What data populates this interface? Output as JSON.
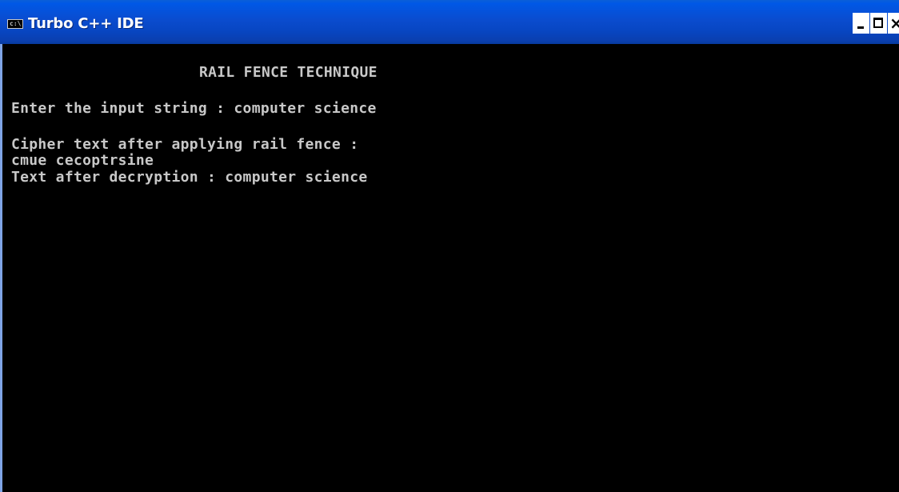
{
  "window": {
    "title": "Turbo C++ IDE",
    "icon": "console-icon",
    "icon_text": "c:\\",
    "buttons": {
      "minimize": "minimize-icon",
      "maximize": "maximize-icon",
      "close": "close-icon",
      "close_glyph": "×"
    }
  },
  "console": {
    "heading": "RAIL FENCE TECHNIQUE",
    "input_line": "Enter the input string : computer science",
    "cipher_label": "Cipher text after applying rail fence :",
    "cipher_value": "cmue cecoptrsine",
    "decrypt_line": "Text after decryption : computer science"
  },
  "colors": {
    "titlebar": "#0a4ccf",
    "console_bg": "#000000",
    "console_text": "#c8c8c8",
    "title_text": "#ffffff"
  }
}
